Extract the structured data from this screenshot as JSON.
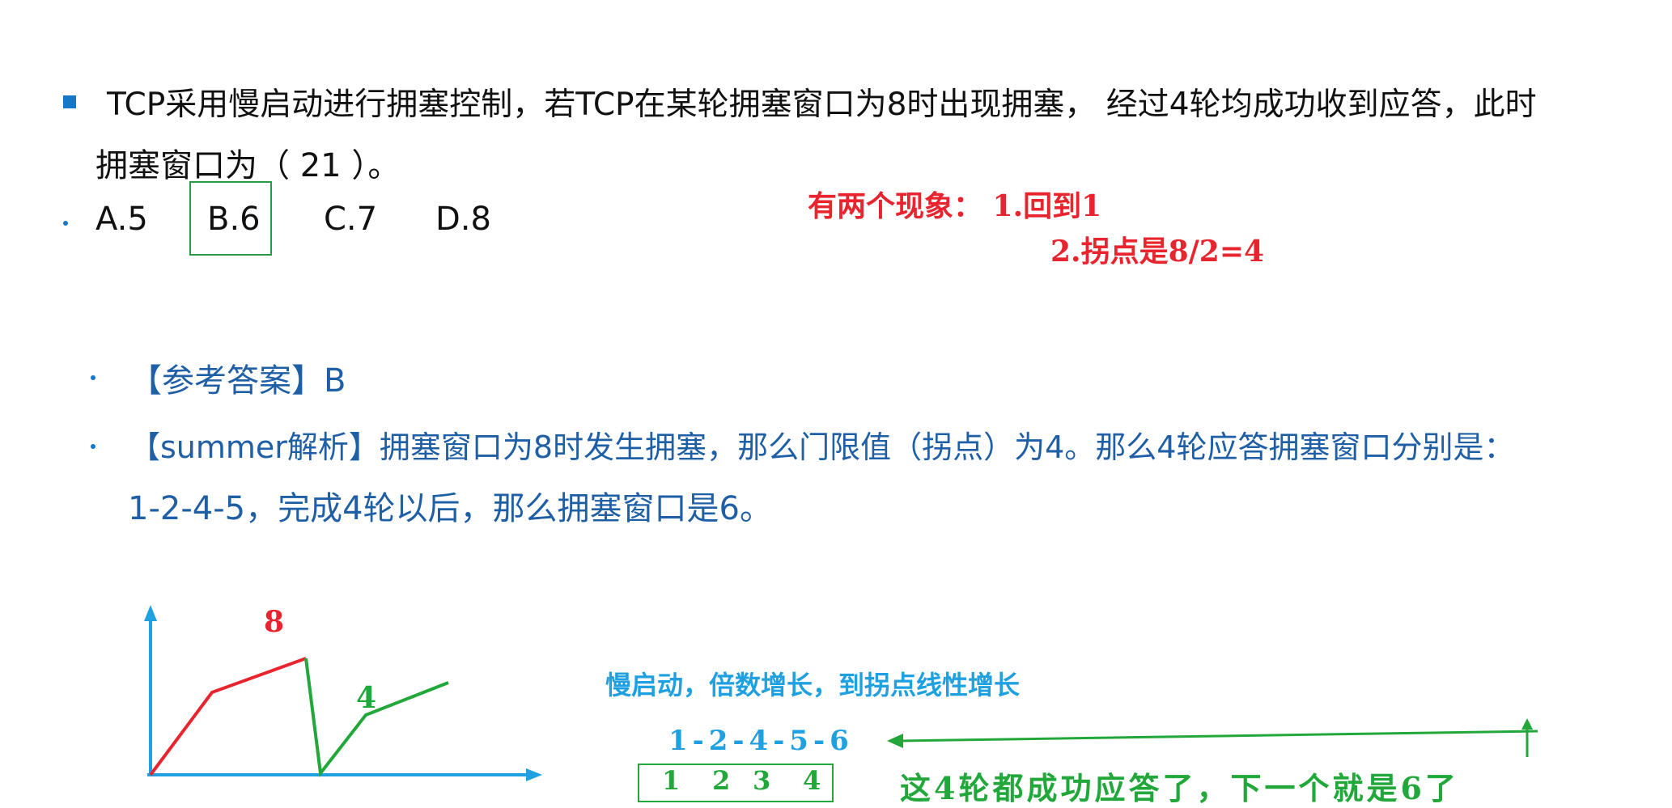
{
  "question": {
    "line1": "TCP采用慢启动进行拥塞控制，若TCP在某轮拥塞窗口为8时出现拥塞， 经过4轮均成功收到应答，此时",
    "line2": "拥塞窗口为（ 21 ）。",
    "options": [
      "A.5",
      "B.6",
      "C.7",
      "D.8"
    ],
    "selected_option": "B.6"
  },
  "annotation_top": {
    "line1": "有两个现象：  1.回到1",
    "line2": "2.拐点是8/2=4"
  },
  "answer": {
    "reference": "【参考答案】B",
    "analysis_line1": "【summer解析】拥塞窗口为8时发生拥塞，那么门限值（拐点）为4。那么4轮应答拥塞窗口分别是：",
    "analysis_line2": "1-2-4-5，完成4轮以后，那么拥塞窗口是6。"
  },
  "graph": {
    "label_peak": "8",
    "label_threshold": "4"
  },
  "notes": {
    "slow_start": "慢启动，倍数增长，到拐点线性增长",
    "sequence": "1-2-4-5-6",
    "rounds": [
      "1",
      "2",
      "3",
      "4"
    ],
    "conclusion": "这4轮都成功应答了，下一个就是6了"
  },
  "colors": {
    "question_text": "#111111",
    "answer_text": "#1f5fa6",
    "bullet": "#1477c8",
    "handwriting_red": "#e8252e",
    "handwriting_green": "#22a83a",
    "handwriting_cyan": "#1fa0e0"
  }
}
